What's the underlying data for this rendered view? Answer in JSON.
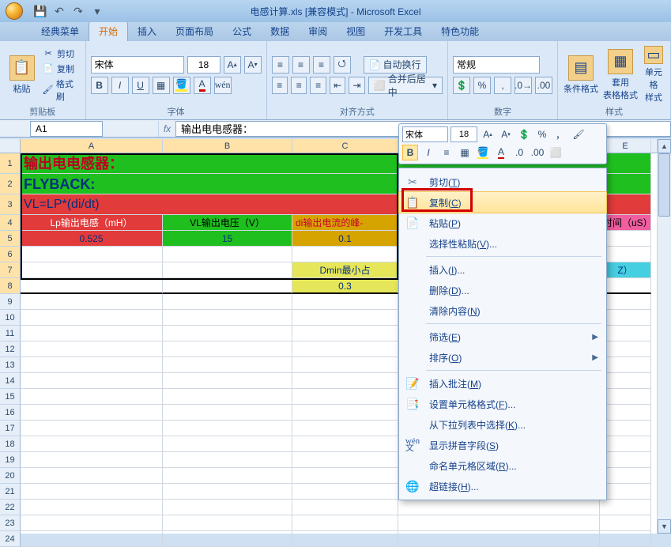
{
  "title": "电感计算.xls  [兼容模式] - Microsoft Excel",
  "tabs": [
    "经典菜单",
    "开始",
    "插入",
    "页面布局",
    "公式",
    "数据",
    "审阅",
    "视图",
    "开发工具",
    "特色功能"
  ],
  "active_tab": 1,
  "clipboard": {
    "cut": "剪切",
    "copy": "复制",
    "brush": "格式刷",
    "paste": "粘贴",
    "group": "剪贴板"
  },
  "font_group": {
    "name": "宋体",
    "size": "18",
    "group": "字体",
    "bold": "B",
    "italic": "I",
    "underline": "U"
  },
  "align_group": {
    "wrap": "自动换行",
    "merge": "合并后居中",
    "group": "对齐方式"
  },
  "number_group": {
    "format": "常规",
    "group": "数字"
  },
  "styles_group": {
    "cond": "条件格式",
    "table": "套用\n表格格式",
    "cell": "单元格\n样式",
    "group": "样式"
  },
  "namebox": "A1",
  "fx_label": "fx",
  "formula": "输出电电感器：",
  "mini": {
    "font": "宋体",
    "size": "18",
    "bold": "B",
    "italic": "I",
    "aa_big": "A",
    "aa_small": "A",
    "percent": "%",
    "comma": "，"
  },
  "columns": [
    "A",
    "B",
    "C",
    "D",
    "E"
  ],
  "cells": {
    "r1": {
      "A": "输出电电感器："
    },
    "r2": {
      "A": "FLYBACK:"
    },
    "r3": {
      "A": "VL=LP*(di/dt)"
    },
    "r4": {
      "A": "Lp输出电感（mH）",
      "B": "VL输出电压（V）",
      "C": "di输出电流的峰-",
      "E": "时间（uS）"
    },
    "r5": {
      "A": "0.525",
      "B": "15",
      "C": "0.1"
    },
    "r7": {
      "C": "Dmin最小占",
      "E": "Z）"
    },
    "r8": {
      "C": "0.3"
    }
  },
  "context_menu": [
    {
      "icon": "✂",
      "label": "剪切",
      "u": "T"
    },
    {
      "icon": "📋",
      "label": "复制",
      "u": "C",
      "hl": true
    },
    {
      "icon": "📄",
      "label": "粘贴",
      "u": "P"
    },
    {
      "icon": "",
      "label": "选择性粘贴",
      "u": "V",
      "suffix": "..."
    },
    {
      "sep": true
    },
    {
      "icon": "",
      "label": "插入",
      "u": "I",
      "suffix": "..."
    },
    {
      "icon": "",
      "label": "删除",
      "u": "D",
      "suffix": "..."
    },
    {
      "icon": "",
      "label": "清除内容",
      "u": "N"
    },
    {
      "sep": true
    },
    {
      "icon": "",
      "label": "筛选",
      "u": "E",
      "sub": true
    },
    {
      "icon": "",
      "label": "排序",
      "u": "O",
      "sub": true
    },
    {
      "sep": true
    },
    {
      "icon": "📝",
      "label": "插入批注",
      "u": "M"
    },
    {
      "icon": "📑",
      "label": "设置单元格格式",
      "u": "F",
      "suffix": "..."
    },
    {
      "icon": "",
      "label": "从下拉列表中选择",
      "u": "K",
      "suffix": "..."
    },
    {
      "icon": "wén",
      "label": "显示拼音字段",
      "u": "S"
    },
    {
      "icon": "",
      "label": "命名单元格区域",
      "u": "R",
      "suffix": "..."
    },
    {
      "icon": "🌐",
      "label": "超链接",
      "u": "H",
      "suffix": "..."
    }
  ]
}
